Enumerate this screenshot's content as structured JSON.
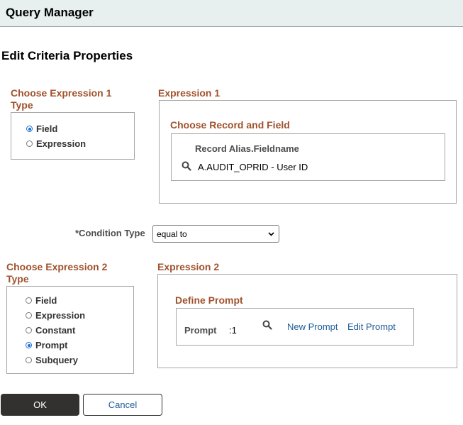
{
  "header": {
    "title": "Query Manager"
  },
  "page_title": "Edit Criteria Properties",
  "expr1_type": {
    "heading_line1": "Choose Expression 1",
    "heading_line2": "Type",
    "options": [
      "Field",
      "Expression"
    ],
    "selected": "Field"
  },
  "expr1": {
    "heading": "Expression 1",
    "subheading": "Choose Record and Field",
    "column_header": "Record Alias.Fieldname",
    "value": "A.AUDIT_OPRID - User ID"
  },
  "condition": {
    "label": "*Condition Type",
    "value": "equal to"
  },
  "expr2_type": {
    "heading_line1": "Choose Expression 2",
    "heading_line2": "Type",
    "options": [
      "Field",
      "Expression",
      "Constant",
      "Prompt",
      "Subquery"
    ],
    "selected": "Prompt"
  },
  "expr2": {
    "heading": "Expression 2",
    "subheading": "Define Prompt",
    "prompt_label": "Prompt",
    "prompt_value": ":1",
    "new_prompt": "New Prompt",
    "edit_prompt": "Edit Prompt"
  },
  "buttons": {
    "ok": "OK",
    "cancel": "Cancel"
  },
  "colors": {
    "section_heading": "#a0522d",
    "link": "#1f5c99",
    "radio_selected": "#1a6ed8",
    "ok_bg": "#333130"
  },
  "icons": {
    "search": "search-icon",
    "dropdown": "chevron-down-icon"
  }
}
